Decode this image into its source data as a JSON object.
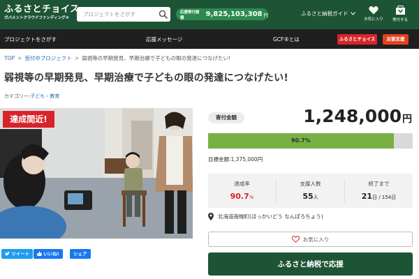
{
  "header": {
    "logo_main": "ふるさとチョイス",
    "logo_sub": "ガバメントクラウドファンディング®",
    "search_placeholder": "プロジェクトをさがす",
    "total_label": "応援寄付総額",
    "total_value": "9,825,103,308",
    "total_unit": "円",
    "guide_label": "ふるさと納税ガイド",
    "favorites_label": "お気に入り",
    "donated_label": "寄付する"
  },
  "nav": {
    "items": [
      "プロジェクトをさがす",
      "応援メッセージ",
      "GCF®とは"
    ],
    "buttons": [
      {
        "label": "ふるさとチョイス",
        "color": "#d8232a"
      },
      {
        "label": "災害支援",
        "color": "#e0421b"
      }
    ]
  },
  "breadcrumb": [
    "TOP",
    "受付中プロジェクト",
    "弱視等の早期発見、早期治療で子どもの眼の発達につなげたい!"
  ],
  "title": "弱視等の早期発見、早期治療で子どもの眼の発達につなげたい!",
  "category": {
    "label": "カテゴリー:",
    "value": "子ども・教育"
  },
  "photo_badge": "達成間近!",
  "share": {
    "tweet": "ツイート",
    "like": "いいね!",
    "share": "シェア"
  },
  "funding": {
    "label": "寄付金額",
    "amount": "1,248,000",
    "unit": "円",
    "progress_text": "90.7%",
    "progress": 0.907,
    "goal_text": "目標金額:1,375,000円"
  },
  "stats": [
    {
      "label": "達成率",
      "value": "90.7",
      "unit": "%",
      "highlight": true
    },
    {
      "label": "支援人数",
      "value": "55",
      "unit": "人",
      "highlight": false
    },
    {
      "label": "終了まで",
      "value": "21",
      "unit": "日 / 154日",
      "highlight": false
    }
  ],
  "location": "北海道南幌町(ほっかいどう なんぽろちょう)",
  "buttons": {
    "favorite": "お気に入り",
    "donate": "ふるさと納税で応援"
  },
  "colors": {
    "brand_green": "#1e5436",
    "accent_red": "#d8232a",
    "progress_green": "#78b045",
    "link_blue": "#2a6db5"
  }
}
